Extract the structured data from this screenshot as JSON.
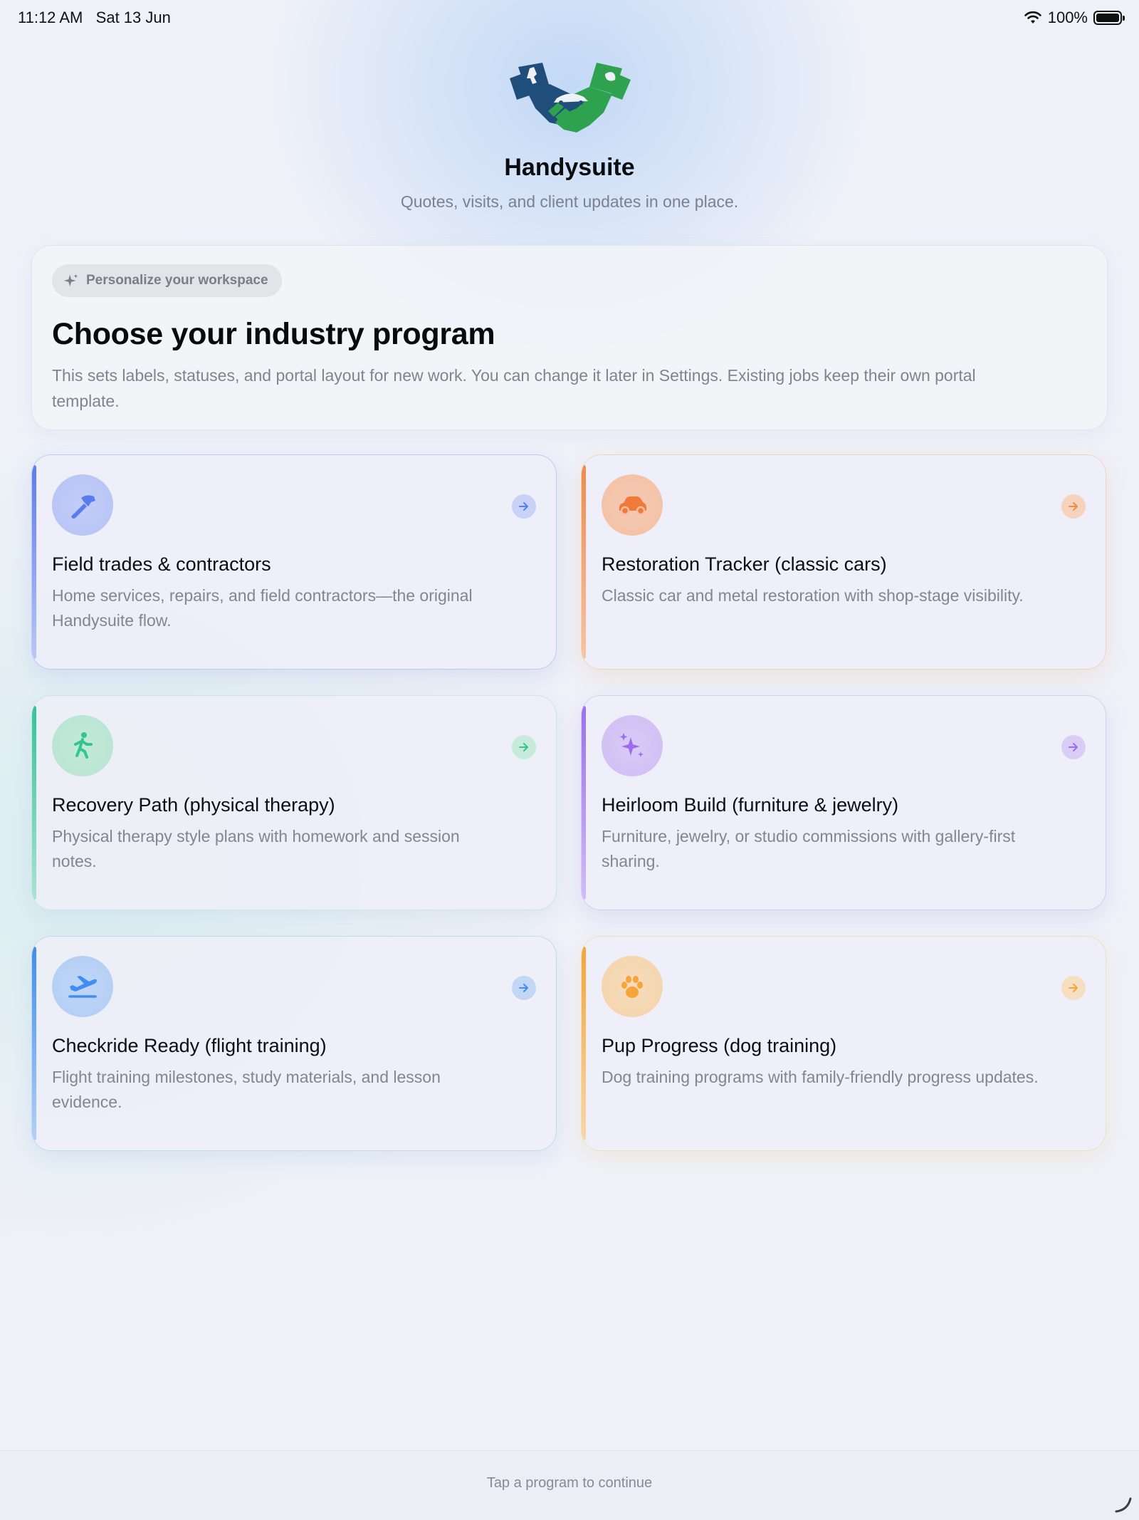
{
  "status_bar": {
    "time": "11:12 AM",
    "date": "Sat 13 Jun",
    "battery": "100%",
    "wifi_icon": "wifi-icon",
    "battery_icon": "battery-icon"
  },
  "header": {
    "logo_icon": "handshake-logo-icon",
    "title": "Handysuite",
    "subtitle": "Quotes, visits, and client updates in one place."
  },
  "intro": {
    "pill_icon": "sparkle-icon",
    "pill_label": "Personalize your workspace",
    "heading": "Choose your industry program",
    "description": "This sets labels, statuses, and portal layout for new work. You can change it later in Settings. Existing jobs keep their own portal template."
  },
  "programs": [
    {
      "title": "Field trades & contractors",
      "description": "Home services, repairs, and field contractors—the original Handysuite flow.",
      "icon": "hammer-icon",
      "accent": "#5b7cf0"
    },
    {
      "title": "Restoration Tracker (classic cars)",
      "description": "Classic car and metal restoration with shop-stage visibility.",
      "icon": "car-icon",
      "accent": "#f08a4b"
    },
    {
      "title": "Recovery Path (physical therapy)",
      "description": "Physical therapy style plans with homework and session notes.",
      "icon": "walking-person-icon",
      "accent": "#34c495"
    },
    {
      "title": "Heirloom Build (furniture & jewelry)",
      "description": "Furniture, jewelry, or studio commissions with gallery-first sharing.",
      "icon": "sparkles-icon",
      "accent": "#9b6ef0"
    },
    {
      "title": "Checkride Ready (flight training)",
      "description": "Flight training milestones, study materials, and lesson evidence.",
      "icon": "airplane-takeoff-icon",
      "accent": "#3f8ef0"
    },
    {
      "title": "Pup Progress (dog training)",
      "description": "Dog training programs with family-friendly progress updates.",
      "icon": "paw-icon",
      "accent": "#f5a53a"
    }
  ],
  "footer": {
    "hint": "Tap a program to continue"
  }
}
